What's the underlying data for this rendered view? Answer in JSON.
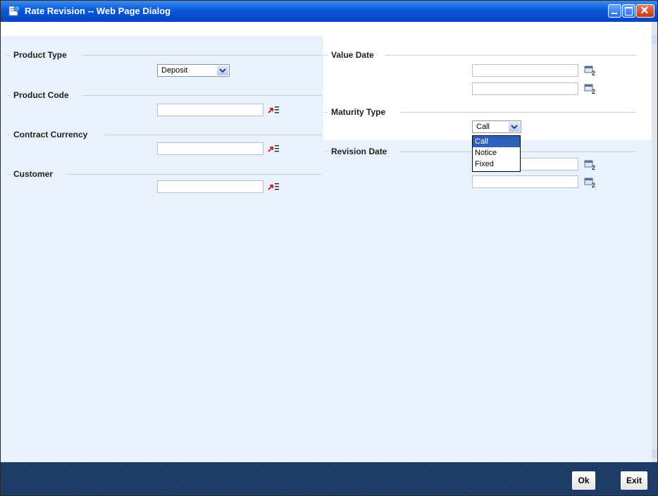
{
  "window": {
    "title": "Rate Revision -- Web Page Dialog"
  },
  "left": {
    "product_type": {
      "label": "Product Type",
      "selected": "Deposit"
    },
    "product_code": {
      "label": "Product Code",
      "value": ""
    },
    "contract_currency": {
      "label": "Contract Currency",
      "value": ""
    },
    "customer": {
      "label": "Customer",
      "value": ""
    }
  },
  "right": {
    "value_date": {
      "label": "Value Date",
      "from": "",
      "to": ""
    },
    "maturity_type": {
      "label": "Maturity Type",
      "selected": "Call",
      "options": [
        "Call",
        "Notice",
        "Fixed"
      ],
      "highlighted": "Call"
    },
    "revision_date": {
      "label": "Revision Date",
      "from": "",
      "to": ""
    }
  },
  "footer": {
    "ok_label": "Ok",
    "exit_label": "Exit"
  },
  "colors": {
    "titlebar": "#0758d8",
    "content_bg": "#e9f1fc",
    "footer_bg": "#1c3863",
    "selection": "#2f5fbd"
  },
  "icons": {
    "lov": "list-of-values-icon",
    "calendar": "calendar-icon",
    "title": "ie-page-icon"
  }
}
